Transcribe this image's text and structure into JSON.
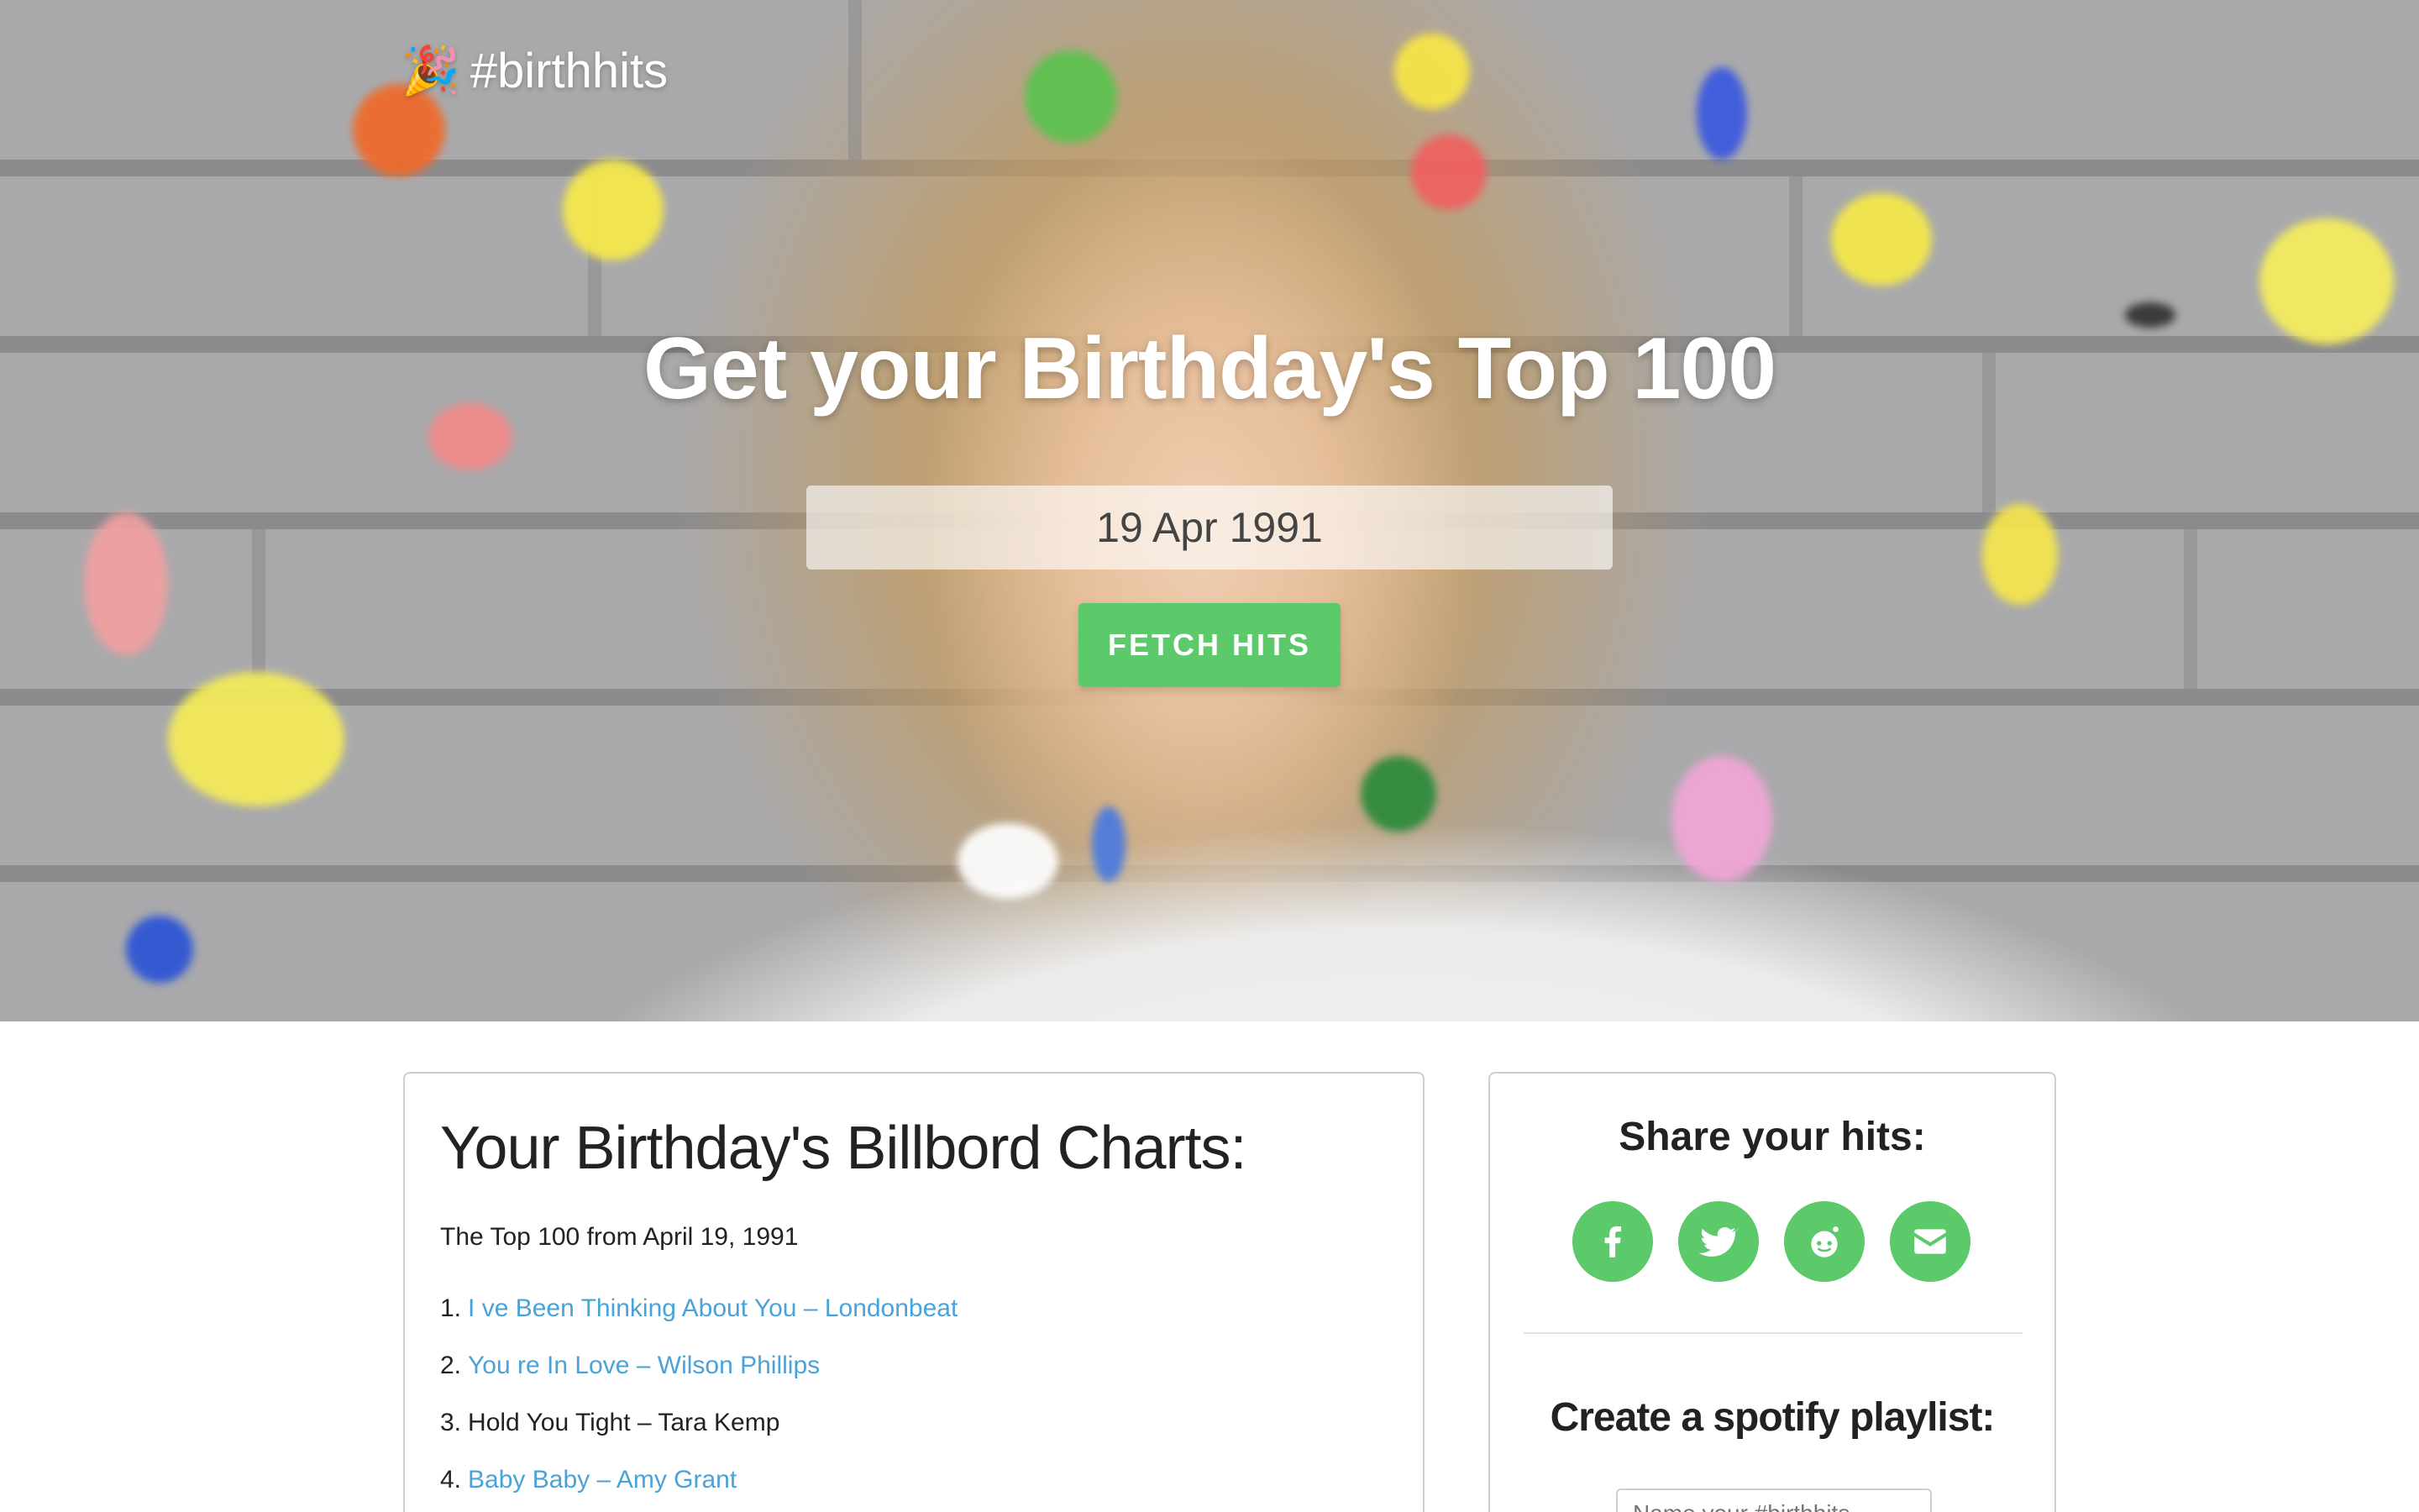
{
  "brand": {
    "icon": "party-popper-icon",
    "name": "#birthhits"
  },
  "hero": {
    "title": "Get your Birthday's Top 100",
    "date_value": "19 Apr 1991",
    "fetch_label": "FETCH HITS"
  },
  "colors": {
    "accent": "#5cc96a",
    "link": "#4aa3d8"
  },
  "charts": {
    "title": "Your Birthday's Billbord Charts:",
    "subtitle": "The Top 100 from April 19, 1991",
    "hits": [
      {
        "rank": "1.",
        "title": "I ve Been Thinking About You – Londonbeat",
        "linked": true
      },
      {
        "rank": "2.",
        "title": "You re In Love – Wilson Phillips",
        "linked": true
      },
      {
        "rank": "3.",
        "title": "Hold You Tight – Tara Kemp",
        "linked": false
      },
      {
        "rank": "4.",
        "title": "Baby Baby – Amy Grant",
        "linked": true
      }
    ]
  },
  "share": {
    "title": "Share your hits:",
    "buttons": [
      {
        "name": "facebook",
        "icon": "facebook-icon"
      },
      {
        "name": "twitter",
        "icon": "twitter-icon"
      },
      {
        "name": "reddit",
        "icon": "reddit-icon"
      },
      {
        "name": "email",
        "icon": "envelope-icon"
      }
    ]
  },
  "spotify": {
    "title": "Create a spotify playlist:",
    "placeholder": "Name your #birthhits"
  }
}
